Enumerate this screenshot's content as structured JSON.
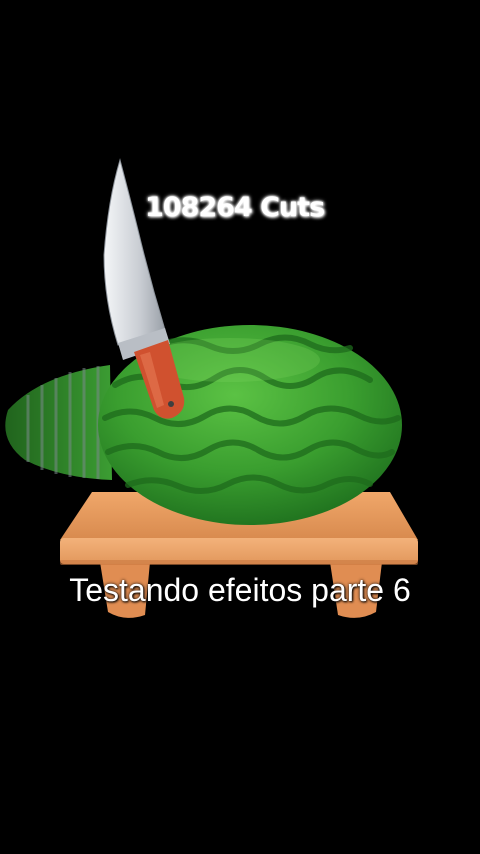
{
  "hud": {
    "cut_count": "108264 Cuts"
  },
  "caption": {
    "text": "Testando efeitos parte 6"
  },
  "colors": {
    "background": "#000000",
    "watermelon_dark": "#1f7a1f",
    "watermelon_light": "#4cb53a",
    "board": "#e0955a",
    "knife_blade": "#d9dde3",
    "knife_handle": "#d0512f"
  },
  "icons": {
    "knife": "knife-icon",
    "watermelon": "watermelon-icon",
    "cutting_board": "cutting-board-icon"
  }
}
